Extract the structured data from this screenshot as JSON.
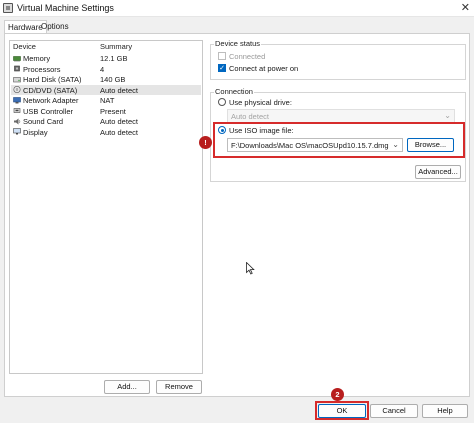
{
  "window": {
    "title": "Virtual Machine Settings",
    "close_glyph": "✕"
  },
  "tabs": [
    {
      "label": "Hardware",
      "active": true
    },
    {
      "label": "Options",
      "active": false
    }
  ],
  "device_list": {
    "columns": [
      "Device",
      "Summary"
    ],
    "rows": [
      {
        "device": "Memory",
        "summary": "12.1 GB",
        "icon": "memory-icon",
        "selected": false
      },
      {
        "device": "Processors",
        "summary": "4",
        "icon": "processor-icon",
        "selected": false
      },
      {
        "device": "Hard Disk (SATA)",
        "summary": "140 GB",
        "icon": "hard-disk-icon",
        "selected": false
      },
      {
        "device": "CD/DVD (SATA)",
        "summary": "Auto detect",
        "icon": "cd-dvd-icon",
        "selected": true
      },
      {
        "device": "Network Adapter",
        "summary": "NAT",
        "icon": "network-icon",
        "selected": false
      },
      {
        "device": "USB Controller",
        "summary": "Present",
        "icon": "usb-icon",
        "selected": false
      },
      {
        "device": "Sound Card",
        "summary": "Auto detect",
        "icon": "sound-icon",
        "selected": false
      },
      {
        "device": "Display",
        "summary": "Auto detect",
        "icon": "display-icon",
        "selected": false
      }
    ],
    "add_label": "Add...",
    "remove_label": "Remove"
  },
  "device_status": {
    "title": "Device status",
    "connected_label": "Connected",
    "connected_checked": false,
    "connect_power_label": "Connect at power on",
    "connect_power_checked": true
  },
  "connection": {
    "title": "Connection",
    "physical_label": "Use physical drive:",
    "physical_selected": false,
    "physical_value": "Auto detect",
    "iso_label": "Use ISO image file:",
    "iso_selected": true,
    "iso_path": "F:\\Downloads\\Mac OS\\macOSUpd10.15.7.dmg",
    "browse_label": "Browse...",
    "advanced_label": "Advanced..."
  },
  "markers": {
    "one": "!",
    "two": "2"
  },
  "footer": {
    "ok_label": "OK",
    "cancel_label": "Cancel",
    "help_label": "Help"
  },
  "colors": {
    "accent": "#0067c0",
    "highlight": "#d62b2b",
    "marker": "#b81e1e"
  }
}
